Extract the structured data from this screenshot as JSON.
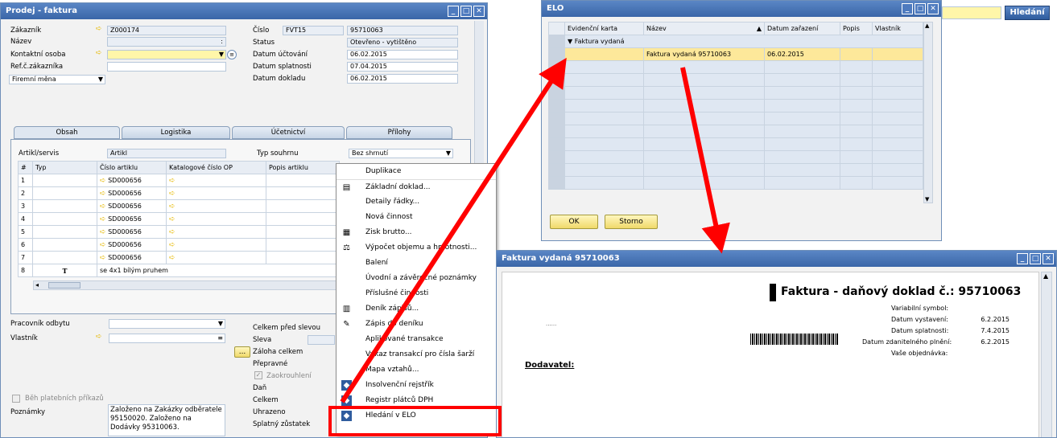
{
  "sales_window": {
    "title": "Prodej - faktura",
    "labels": {
      "customer": "Zákazník",
      "name": "Název",
      "contact": "Kontaktní osoba",
      "ref": "Ref.č.zákazníka",
      "currency": "Firemní měna",
      "number": "Číslo",
      "status": "Status",
      "posting_date": "Datum účtování",
      "due_date": "Datum splatnosti",
      "doc_date": "Datum dokladu"
    },
    "values": {
      "customer": "Z000174",
      "name_sep": ":",
      "series": "FVT15",
      "number": "95710063",
      "status": "Otevřeno - vytištěno",
      "posting_date": "06.02.2015",
      "due_date": "07.04.2015",
      "doc_date": "06.02.2015"
    },
    "tabs": [
      "Obsah",
      "Logistika",
      "Účetnictví",
      "Přílohy"
    ],
    "item_label": "Artikl/servis",
    "item_value": "Artikl",
    "summary_label": "Typ souhrnu",
    "summary_value": "Bez shrnutí",
    "columns": [
      "#",
      "Typ",
      "Číslo artiklu",
      "Katalogové číslo OP",
      "Popis artiklu"
    ],
    "rows": [
      {
        "n": "1",
        "item": "SD000656"
      },
      {
        "n": "2",
        "item": "SD000656"
      },
      {
        "n": "3",
        "item": "SD000656"
      },
      {
        "n": "4",
        "item": "SD000656"
      },
      {
        "n": "5",
        "item": "SD000656"
      },
      {
        "n": "6",
        "item": "SD000656"
      },
      {
        "n": "7",
        "item": "SD000656"
      }
    ],
    "row8": {
      "n": "8",
      "type": "T",
      "text": "se 4x1 bílým pruhem"
    },
    "bottom": {
      "sales_employee": "Pracovník odbytu",
      "owner": "Vlastník",
      "payment_block": "Běh platebních příkazů",
      "notes_label": "Poznámky",
      "notes": "Založeno na Zakázky odběratele 95150020. Založeno na Dodávky 95310063.",
      "total_before": "Celkem před slevou",
      "discount": "Sleva",
      "advance": "Záloha celkem",
      "freight": "Přepravné",
      "rounding": "Zaokrouhlení",
      "tax": "Daň",
      "total": "Celkem",
      "paid": "Uhrazeno",
      "balance": "Splatný zůstatek"
    }
  },
  "context_menu": {
    "items": [
      {
        "label": "Duplikace",
        "icon": ""
      },
      {
        "label": "Základní doklad...",
        "icon": "doc-icon"
      },
      {
        "label": "Detaily řádky...",
        "icon": ""
      },
      {
        "label": "Nová činnost",
        "icon": ""
      },
      {
        "label": "Zisk brutto...",
        "icon": "chart-icon"
      },
      {
        "label": "Výpočet objemu a hmotnosti...",
        "icon": "scale-icon"
      },
      {
        "label": "Balení",
        "icon": ""
      },
      {
        "label": "Úvodní a závěrečné poznámky",
        "icon": ""
      },
      {
        "label": "Příslušné činnosti",
        "icon": ""
      },
      {
        "label": "Deník zápisů...",
        "icon": "book-icon"
      },
      {
        "label": "Zápis do deníku",
        "icon": "journal-icon"
      },
      {
        "label": "Aplikované transakce",
        "icon": ""
      },
      {
        "label": "Výkaz transakcí pro čísla šarží",
        "icon": ""
      },
      {
        "label": "Mapa vztahů...",
        "icon": ""
      },
      {
        "label": "Insolvenční rejstřík",
        "icon": "elo-icon"
      },
      {
        "label": "Registr plátců DPH",
        "icon": "elo-icon"
      },
      {
        "label": "Hledání v ELO",
        "icon": "elo-icon"
      }
    ]
  },
  "elo_window": {
    "title": "ELO",
    "columns": [
      "Evidenční karta",
      "Název",
      "Datum zařazení",
      "Popis",
      "Vlastník"
    ],
    "group": "Faktura vydaná",
    "row": {
      "name": "Faktura vydaná 95710063",
      "date": "06.02.2015"
    },
    "ok": "OK",
    "cancel": "Storno"
  },
  "search_button": "Hledání",
  "invoice_window": {
    "title": "Faktura vydaná 95710063",
    "heading": "Faktura - daňový doklad č.: 95710063",
    "fields": [
      {
        "label": "Variabilní symbol:",
        "value": ""
      },
      {
        "label": "Datum vystavení:",
        "value": "6.2.2015"
      },
      {
        "label": "Datum splatnosti:",
        "value": "7.4.2015"
      },
      {
        "label": "Datum zdanitelného plnění:",
        "value": "6.2.2015"
      },
      {
        "label": "Vaše objednávka:",
        "value": ""
      }
    ],
    "supplier": "Dodavatel:",
    "dots": "......"
  },
  "colors": {
    "title_bar": "#3a66a8",
    "highlight": "#fff6a9",
    "arrow": "#ff0000"
  }
}
